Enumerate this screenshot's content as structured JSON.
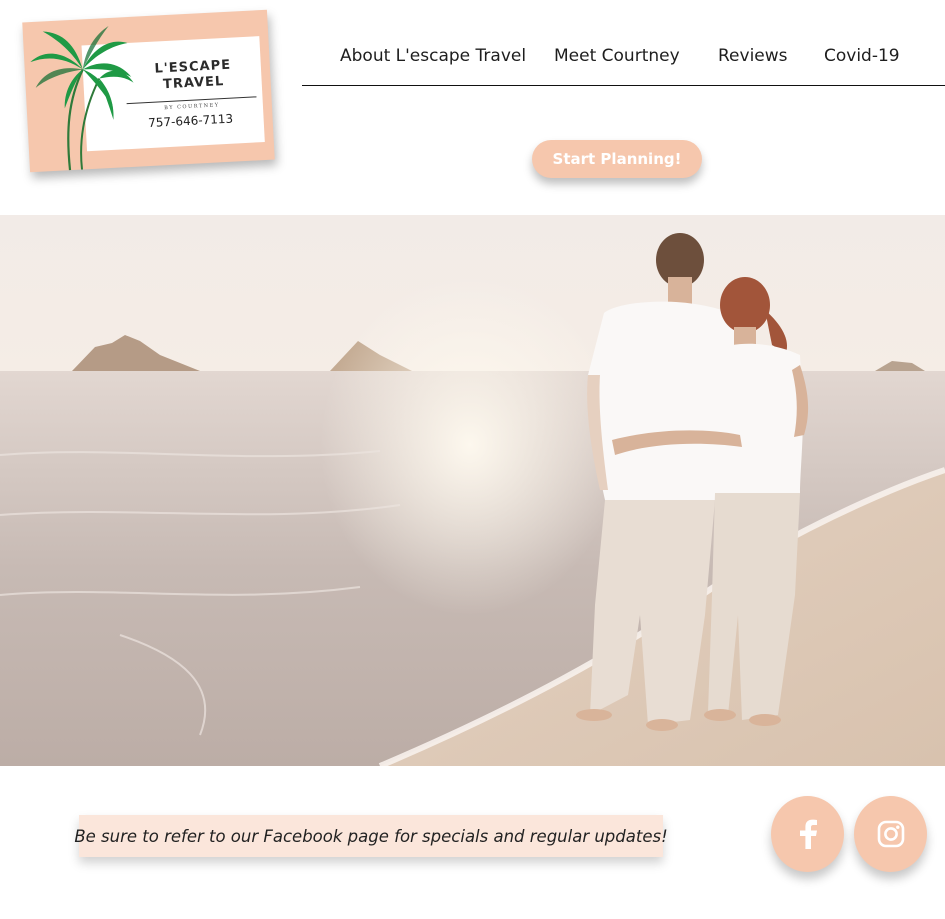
{
  "brand": {
    "name_line1": "L'ESCAPE",
    "name_line2": "TRAVEL",
    "byline": "BY COURTNEY",
    "phone": "757-646-7113",
    "colors": {
      "accent": "#f6c7ad",
      "palm": "#1a8a3a"
    }
  },
  "nav": {
    "items": [
      {
        "label": "About L'escape Travel"
      },
      {
        "label": "Meet Courtney"
      },
      {
        "label": "Reviews"
      },
      {
        "label": "Covid-19"
      }
    ]
  },
  "cta": {
    "label": "Start Planning!"
  },
  "hero": {
    "image": "couple-on-beach-at-sunset"
  },
  "footer": {
    "notice": "Be sure to refer to our Facebook page for specials and regular updates!",
    "social": [
      {
        "icon": "facebook-icon"
      },
      {
        "icon": "instagram-icon"
      }
    ]
  }
}
